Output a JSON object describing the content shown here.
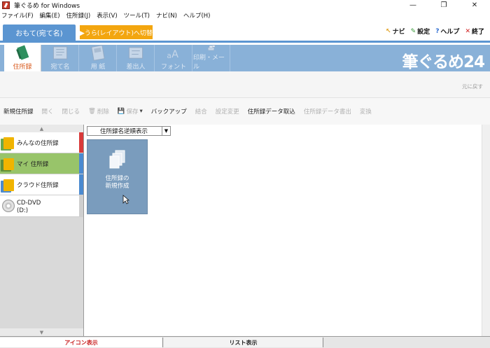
{
  "window": {
    "title": "筆ぐるめ for Windows",
    "controls": [
      "—",
      "❐",
      "✕"
    ]
  },
  "menu": [
    "ファイル(F)",
    "編集(E)",
    "住所録(J)",
    "表示(V)",
    "ツール(T)",
    "ナビ(N)",
    "ヘルプ(H)"
  ],
  "mode": {
    "omote_label": "おもて(宛て名)",
    "ura_label": "▶うら(レイアウト)へ切替",
    "right_links": {
      "navi": "ナビ",
      "settings": "設定",
      "help": "ヘルプ",
      "exit": "終了"
    }
  },
  "ribbon": {
    "items": [
      {
        "label": "住所録",
        "active": true
      },
      {
        "label": "宛て名",
        "active": false
      },
      {
        "label": "用 紙",
        "active": false
      },
      {
        "label": "差出人",
        "active": false
      },
      {
        "label": "フォント",
        "active": false
      },
      {
        "label": "印刷・メール",
        "active": false
      }
    ],
    "brand": "筆ぐるめ24"
  },
  "undo_label": "元に戻す",
  "toolbar": {
    "new": "新規住所録",
    "open": "開く",
    "close": "閉じる",
    "delete": "削除",
    "save": "保存",
    "backup": "バックアップ",
    "merge": "結合",
    "settings_change": "設定変更",
    "import": "住所録データ取込",
    "export": "住所録データ書出",
    "convert": "変換"
  },
  "left_panel": {
    "items": [
      {
        "label": "みんなの住所録",
        "stripe": "#d93a3a",
        "book": "#f0b400"
      },
      {
        "label": "マイ 住所録",
        "stripe": "#4b8ad0",
        "book": "#f0b400"
      },
      {
        "label": "クラウド住所録",
        "stripe": "#4b8ad0",
        "book": "#f0b400"
      }
    ],
    "dvd_label_1": "CD-DVD",
    "dvd_label_2": "(D:)"
  },
  "main": {
    "sort_label": "住所録名逆順表示",
    "new_book_line1": "住所録の",
    "new_book_line2": "新規作成"
  },
  "bottom_tabs": {
    "icon_view": "アイコン表示",
    "list_view": "リスト表示"
  },
  "colors": {
    "accent_blue": "#5b95d1",
    "ribbon_bg": "#89b1d8",
    "ura_orange": "#f3a60f",
    "selected_green": "#98c46a",
    "active_label": "#d8591c"
  }
}
